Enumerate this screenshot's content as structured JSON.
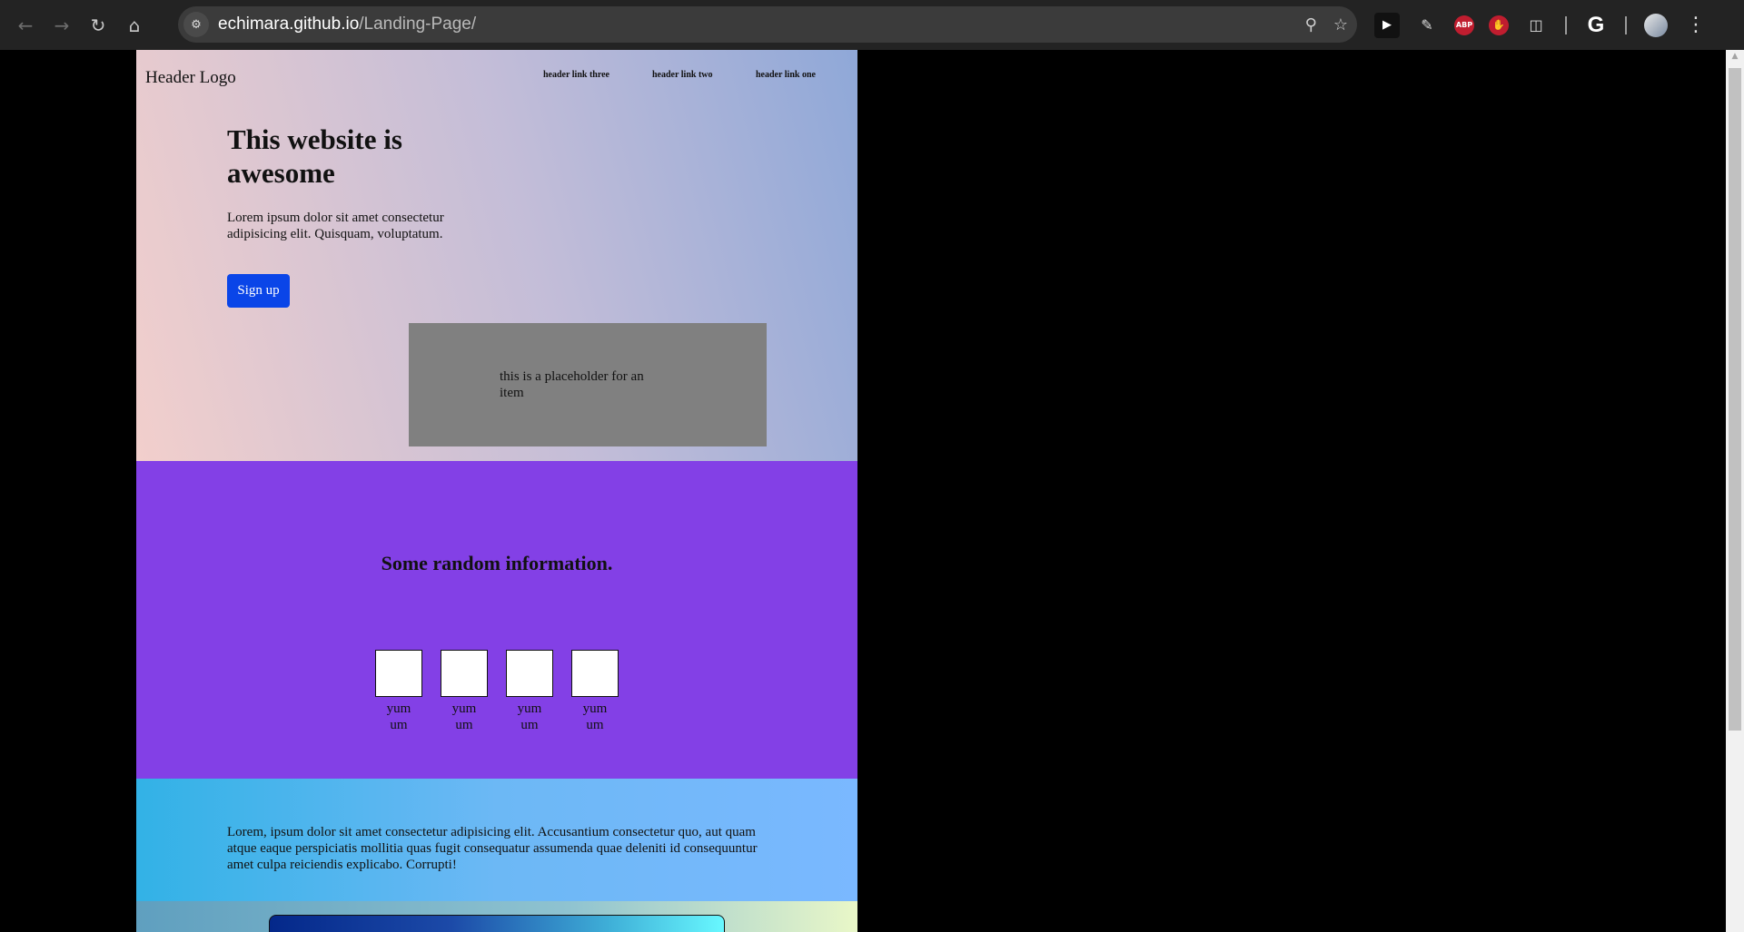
{
  "browser": {
    "url_host": "echimara.github.io",
    "url_path": "/Landing-Page/",
    "nav_icons": [
      "back-arrow-icon",
      "forward-arrow-icon",
      "reload-icon",
      "home-icon"
    ],
    "extensions": [
      "youtube-ext-icon",
      "eyedropper-icon",
      "adblock-plus-icon",
      "stop-hand-icon",
      "puzzle-extensions-icon",
      "google-icon",
      "profile-avatar",
      "menu-kebab-icon"
    ],
    "abp_label": "ABP",
    "google_label": "G"
  },
  "page": {
    "header": {
      "logo": "Header Logo",
      "links": [
        "header link three",
        "header link two",
        "header link one"
      ]
    },
    "hero": {
      "title": "This website is awesome",
      "text": "Lorem ipsum dolor sit amet consectetur adipisicing elit. Quisquam, voluptatum.",
      "button": "Sign up",
      "placeholder": "this is a placeholder for an item"
    },
    "info": {
      "title": "Some random information.",
      "tiles": [
        "yum um",
        "yum um",
        "yum um",
        "yum um"
      ]
    },
    "lorem": {
      "text": "Lorem, ipsum dolor sit amet consectetur adipisicing elit. Accusantium consectetur quo, aut quam atque eaque perspiciatis mollitia quas fugit consequatur assumenda quae deleniti id consequuntur amet culpa reiciendis explicabo. Corrupti!"
    }
  },
  "colors": {
    "signup_button": "#0a45e8",
    "info_bg": "#8340e6",
    "placeholder_bg": "#808080",
    "browser_bg": "#232323"
  }
}
